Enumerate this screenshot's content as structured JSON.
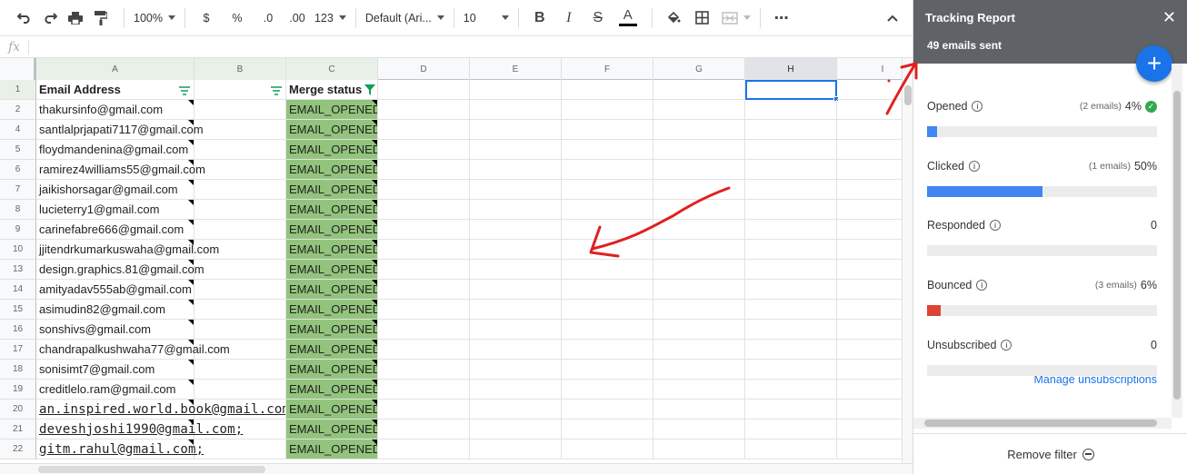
{
  "toolbar": {
    "zoom": "100%",
    "currency": "$",
    "percent": "%",
    "decrease_decimal": ".0",
    "increase_decimal": ".00",
    "more_formats": "123",
    "font": "Default (Ari...",
    "font_size": "10",
    "bold": "B",
    "italic": "I",
    "strikethrough": "S",
    "text_color": "A",
    "more": "⋯",
    "text_color_value": "#000000"
  },
  "formula_bar": {
    "fx": "fx",
    "value": ""
  },
  "columns": [
    "A",
    "B",
    "C",
    "D",
    "E",
    "F",
    "G",
    "H",
    "I"
  ],
  "header_row": {
    "num": "1",
    "a": "Email Address",
    "b": "",
    "c": "Merge status"
  },
  "rows": [
    {
      "num": "2",
      "email": "thakursinfo@gmail.com",
      "status": "EMAIL_OPENED"
    },
    {
      "num": "4",
      "email": "santlalprjapati7117@gmail.com",
      "status": "EMAIL_OPENED"
    },
    {
      "num": "5",
      "email": "floydmandenina@gmail.com",
      "status": "EMAIL_OPENED"
    },
    {
      "num": "6",
      "email": "ramirez4williams55@gmail.com",
      "status": "EMAIL_OPENED"
    },
    {
      "num": "7",
      "email": "jaikishorsagar@gmail.com",
      "status": "EMAIL_OPENED"
    },
    {
      "num": "8",
      "email": "lucieterry1@gmail.com",
      "status": "EMAIL_OPENED"
    },
    {
      "num": "9",
      "email": "carinefabre666@gmail.com",
      "status": "EMAIL_OPENED"
    },
    {
      "num": "10",
      "email": "jjitendrkumarkuswaha@gmail.com",
      "status": "EMAIL_OPENED"
    },
    {
      "num": "13",
      "email": "design.graphics.81@gmail.com",
      "status": "EMAIL_OPENED"
    },
    {
      "num": "14",
      "email": "amityadav555ab@gmail.com",
      "status": "EMAIL_OPENED"
    },
    {
      "num": "15",
      "email": "asimudin82@gmail.com",
      "status": "EMAIL_OPENED"
    },
    {
      "num": "16",
      "email": "sonshivs@gmail.com",
      "status": "EMAIL_OPENED"
    },
    {
      "num": "17",
      "email": "chandrapalkushwaha77@gmail.com",
      "status": "EMAIL_OPENED"
    },
    {
      "num": "18",
      "email": "sonisimt7@gmail.com",
      "status": "EMAIL_OPENED"
    },
    {
      "num": "19",
      "email": "creditlelo.ram@gmail.com",
      "status": "EMAIL_OPENED"
    },
    {
      "num": "20",
      "email": "an.inspired.world.book@gmail.com;",
      "status": "EMAIL_OPENED"
    },
    {
      "num": "21",
      "email": "deveshjoshi1990@gmail.com;",
      "status": "EMAIL_OPENED"
    },
    {
      "num": "22",
      "email": "gitm.rahul@gmail.com;",
      "status": "EMAIL_OPENED"
    }
  ],
  "panel": {
    "title": "Tracking Report",
    "subtitle": "49 emails sent",
    "fab": "+",
    "close": "✕",
    "stats": [
      {
        "label": "Opened",
        "count": "(2 emails)",
        "value": "4%",
        "fraction": 0.04,
        "color": "#4285f4",
        "check": true
      },
      {
        "label": "Clicked",
        "count": "(1 emails)",
        "value": "50%",
        "fraction": 0.5,
        "color": "#4285f4",
        "check": false
      },
      {
        "label": "Responded",
        "count": "",
        "value": "0",
        "fraction": 0,
        "color": "#4285f4",
        "check": false
      },
      {
        "label": "Bounced",
        "count": "(3 emails)",
        "value": "6%",
        "fraction": 0.06,
        "color": "#db4437",
        "check": false
      },
      {
        "label": "Unsubscribed",
        "count": "",
        "value": "0",
        "fraction": 0,
        "color": "#4285f4",
        "check": false
      }
    ],
    "manage_link": "Manage unsubscriptions",
    "remove_filter": "Remove filter"
  },
  "colors": {
    "accent": "#1a73e8",
    "merge_green": "#93c47d",
    "panel_header": "#5f6368",
    "annotation_red": "#e02020"
  }
}
